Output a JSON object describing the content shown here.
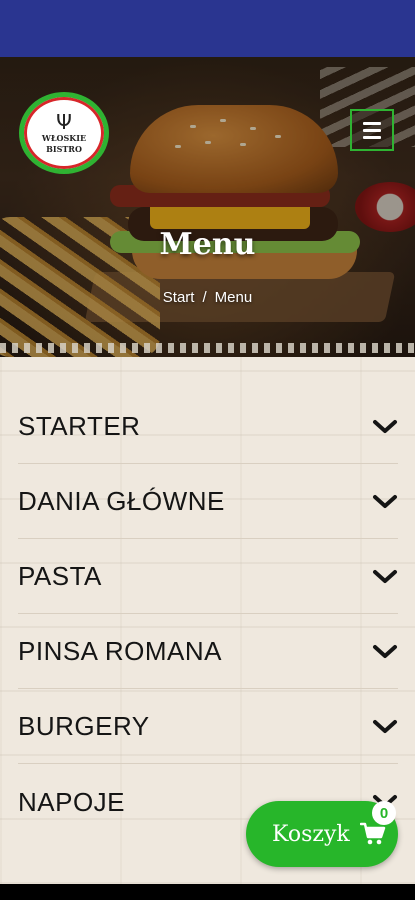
{
  "logo": {
    "top": "WŁOSKIE",
    "bottom": "BISTRO"
  },
  "page": {
    "title": "Menu"
  },
  "breadcrumb": {
    "home": "Start",
    "separator": "/",
    "current": "Menu"
  },
  "categories": [
    {
      "label": "STARTER"
    },
    {
      "label": "DANIA GŁÓWNE"
    },
    {
      "label": "PASTA"
    },
    {
      "label": "PINSA ROMANA"
    },
    {
      "label": "BURGERY"
    },
    {
      "label": "NAPOJE"
    }
  ],
  "cart": {
    "label": "Koszyk",
    "count": "0"
  },
  "colors": {
    "accent": "#27b62a",
    "status_bar": "#2a3590",
    "text": "#151515",
    "logo_red": "#d7262a"
  },
  "icons": {
    "menu": "hamburger-icon",
    "chevron": "chevron-down-icon",
    "cart": "shopping-cart-icon"
  }
}
